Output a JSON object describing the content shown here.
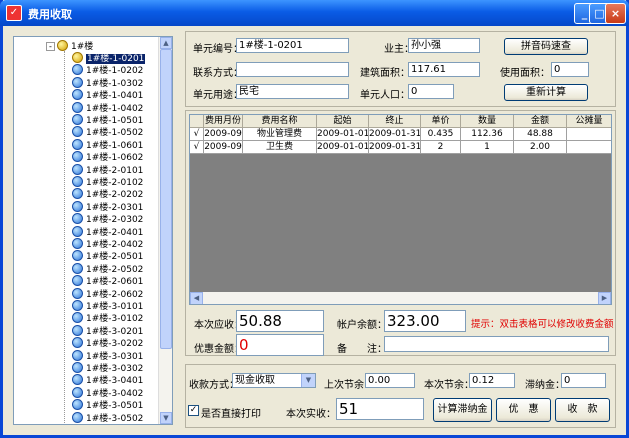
{
  "window": {
    "title": "费用收取",
    "app_icon": "app-icon",
    "min": "_",
    "max": "□",
    "close": "×"
  },
  "tree": {
    "root": "1#楼",
    "items": [
      "1#楼-1-0201",
      "1#楼-1-0202",
      "1#楼-1-0302",
      "1#楼-1-0401",
      "1#楼-1-0402",
      "1#楼-1-0501",
      "1#楼-1-0502",
      "1#楼-1-0601",
      "1#楼-1-0602",
      "1#楼-2-0101",
      "1#楼-2-0102",
      "1#楼-2-0202",
      "1#楼-2-0301",
      "1#楼-2-0302",
      "1#楼-2-0401",
      "1#楼-2-0402",
      "1#楼-2-0501",
      "1#楼-2-0502",
      "1#楼-2-0601",
      "1#楼-2-0602",
      "1#楼-3-0101",
      "1#楼-3-0102",
      "1#楼-3-0201",
      "1#楼-3-0202",
      "1#楼-3-0301",
      "1#楼-3-0302",
      "1#楼-3-0401",
      "1#楼-3-0402",
      "1#楼-3-0501",
      "1#楼-3-0502"
    ],
    "selected_index": 0
  },
  "info": {
    "unit_no_label": "单元编号：",
    "unit_no": "1#楼-1-0201",
    "owner_label": "业主：",
    "owner": "孙小强",
    "pinyin_button": "拼音码速查",
    "contact_label": "联系方式：",
    "contact": "",
    "area_label": "建筑面积：",
    "area": "117.61",
    "use_area_label": "使用面积：",
    "use_area": "0",
    "usage_label": "单元用途：",
    "usage": "民宅",
    "people_label": "单元人口：",
    "people": "0",
    "recalc_button": "重新计算"
  },
  "table": {
    "headers": [
      "",
      "费用月份",
      "费用名称",
      "起始",
      "终止",
      "单价",
      "数量",
      "金额",
      "公摊量"
    ],
    "rows": [
      [
        "√",
        "2009-09",
        "物业管理费",
        "2009-01-01",
        "2009-01-31",
        "0.435",
        "112.36",
        "48.88",
        ""
      ],
      [
        "√",
        "2009-09",
        "卫生费",
        "2009-01-01",
        "2009-01-31",
        "2",
        "1",
        "2.00",
        ""
      ]
    ]
  },
  "summary": {
    "due_label": "本次应收：",
    "due": "50.88",
    "balance_label": "帐户余额：",
    "balance": "323.00",
    "hint": "提示：双击表格可以修改收费金额",
    "discount_label": "优惠金额：",
    "discount": "0",
    "note_label": "备　　注：",
    "note": ""
  },
  "pay": {
    "method_label": "收款方式：",
    "method": "现金收取",
    "last_balance_label": "上次节余：",
    "last_balance": "0.00",
    "this_balance_label": "本次节余：",
    "this_balance": "0.12",
    "late_fee_label": "滞纳金：",
    "late_fee": "0",
    "print_label": "是否直接打印",
    "print_checked": "✓",
    "actual_label": "本次实收：",
    "actual": "51",
    "late_fee_button": "计算滞纳金",
    "discount_button": "优　惠",
    "collect_button": "收　款"
  },
  "colors": {
    "hint": "#e00000",
    "discount": "#e00000",
    "selection": "#0a246a"
  }
}
